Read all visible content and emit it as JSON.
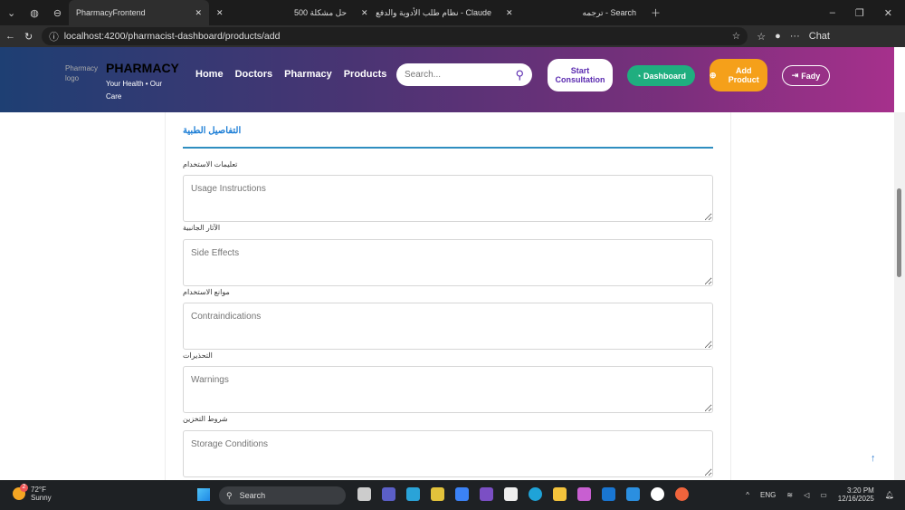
{
  "browser": {
    "tabs": [
      {
        "title": "PharmacyFrontend",
        "active": true
      },
      {
        "title": "حل مشكلة 500"
      },
      {
        "title": "Claude - نظام طلب الأدوية والدفع"
      },
      {
        "title": "Search - ترجمه"
      }
    ],
    "url": "localhost:4200/pharmacist-dashboard/products/add",
    "chat_label": "Chat"
  },
  "header": {
    "logo_alt": "Pharmacy logo",
    "brand": "PHARMACY",
    "tagline": "Your Health • Our Care",
    "nav": [
      "Home",
      "Doctors",
      "Pharmacy",
      "Products"
    ],
    "search_placeholder": "Search...",
    "consult_label": "Start Consultation",
    "dashboard_label": "Dashboard",
    "add_product_label": "Add Product",
    "user_label": "Fady"
  },
  "form": {
    "section_title": "التفاصيل الطبية",
    "fields": [
      {
        "label": "تعليمات الاستخدام",
        "placeholder": "Usage Instructions"
      },
      {
        "label": "الآثار الجانبية",
        "placeholder": "Side Effects"
      },
      {
        "label": "موانع الاستخدام",
        "placeholder": "Contraindications"
      },
      {
        "label": "التحذيرات",
        "placeholder": "Warnings"
      },
      {
        "label": "شروط التخزين",
        "placeholder": "Storage Conditions"
      }
    ]
  },
  "taskbar": {
    "temp": "72°F",
    "weather": "Sunny",
    "badge": "2",
    "search": "Search",
    "lang": "ENG",
    "time": "3:20 PM",
    "date": "12/16/2025"
  }
}
